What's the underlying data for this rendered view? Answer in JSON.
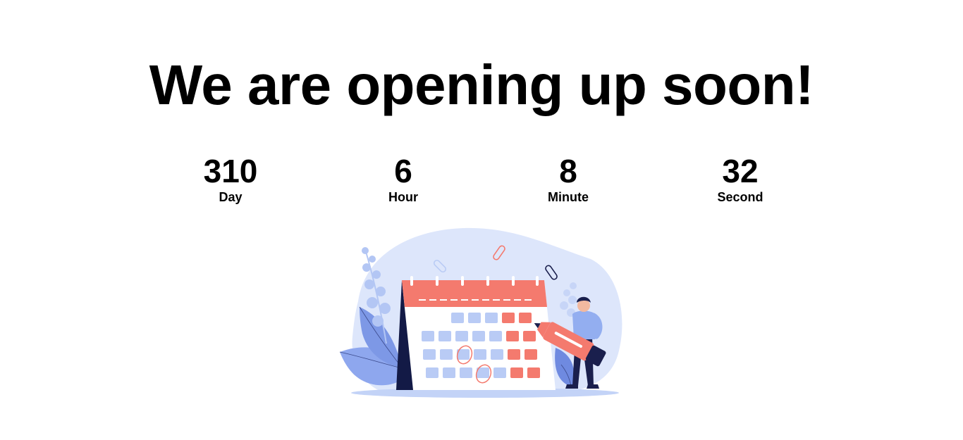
{
  "headline": "We are opening up soon!",
  "countdown": {
    "day": {
      "value": "310",
      "label": "Day"
    },
    "hour": {
      "value": "6",
      "label": "Hour"
    },
    "minute": {
      "value": "8",
      "label": "Minute"
    },
    "second": {
      "value": "32",
      "label": "Second"
    }
  },
  "colors": {
    "calendar_red": "#f47a6e",
    "blob_blue": "#dde6fb",
    "cell_blue": "#b9cbf5",
    "navy": "#1a1f4d"
  }
}
